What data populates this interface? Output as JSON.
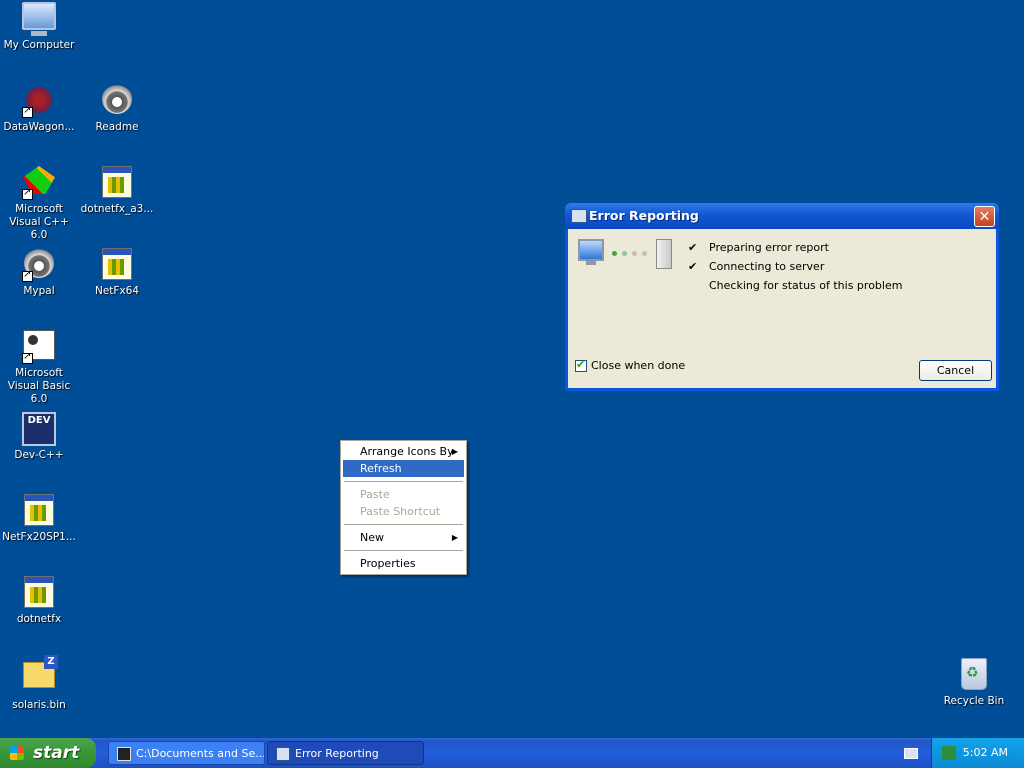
{
  "desktop": {
    "icons": [
      {
        "label": "My Computer",
        "icon": "my-computer-icon"
      },
      {
        "label": "DataWagon...",
        "icon": "datawagon-icon"
      },
      {
        "label": "Readme",
        "icon": "readme-icon"
      },
      {
        "label": "Microsoft Visual C++ 6.0",
        "icon": "visual-cpp-icon"
      },
      {
        "label": "dotnetfx_a3...",
        "icon": "installer-icon"
      },
      {
        "label": "Mypal",
        "icon": "mypal-icon"
      },
      {
        "label": "NetFx64",
        "icon": "installer-icon"
      },
      {
        "label": "Microsoft Visual Basic 6.0",
        "icon": "visual-basic-icon"
      },
      {
        "label": "Dev-C++",
        "icon": "dev-cpp-icon"
      },
      {
        "label": "NetFx20SP1...",
        "icon": "installer-icon"
      },
      {
        "label": "dotnetfx",
        "icon": "installer-icon"
      },
      {
        "label": "solaris.bin",
        "icon": "zip-folder-icon"
      },
      {
        "label": "Recycle Bin",
        "icon": "recycle-bin-icon"
      }
    ],
    "dev_icon_text": "DEV"
  },
  "dialog": {
    "title": "Error Reporting",
    "close_label": "✕",
    "steps": [
      {
        "label": "Preparing error report",
        "done": true
      },
      {
        "label": "Connecting to server",
        "done": true
      },
      {
        "label": "Checking for status of this problem",
        "done": false
      }
    ],
    "check_mark": "✔",
    "close_when_done_label": "Close when done",
    "close_when_done_checked": true,
    "cancel_label": "Cancel"
  },
  "context_menu": {
    "items": [
      {
        "label": "Arrange Icons By",
        "submenu": true,
        "state": "normal"
      },
      {
        "label": "Refresh",
        "submenu": false,
        "state": "highlighted"
      },
      {
        "label": "Paste",
        "submenu": false,
        "state": "disabled"
      },
      {
        "label": "Paste Shortcut",
        "submenu": false,
        "state": "disabled"
      },
      {
        "label": "New",
        "submenu": true,
        "state": "normal"
      },
      {
        "label": "Properties",
        "submenu": false,
        "state": "normal"
      }
    ],
    "submenu_arrow": "▶"
  },
  "taskbar": {
    "start_label": "start",
    "tasks": [
      {
        "label": "C:\\Documents and Se...",
        "icon": "7zip-icon"
      },
      {
        "label": "Error Reporting",
        "icon": "error-reporting-icon"
      }
    ],
    "clock": "5:02 AM"
  },
  "colors": {
    "desktop_bg": "#004e98",
    "menu_highlight": "#316ac5",
    "titlebar": "#0a56dc"
  }
}
